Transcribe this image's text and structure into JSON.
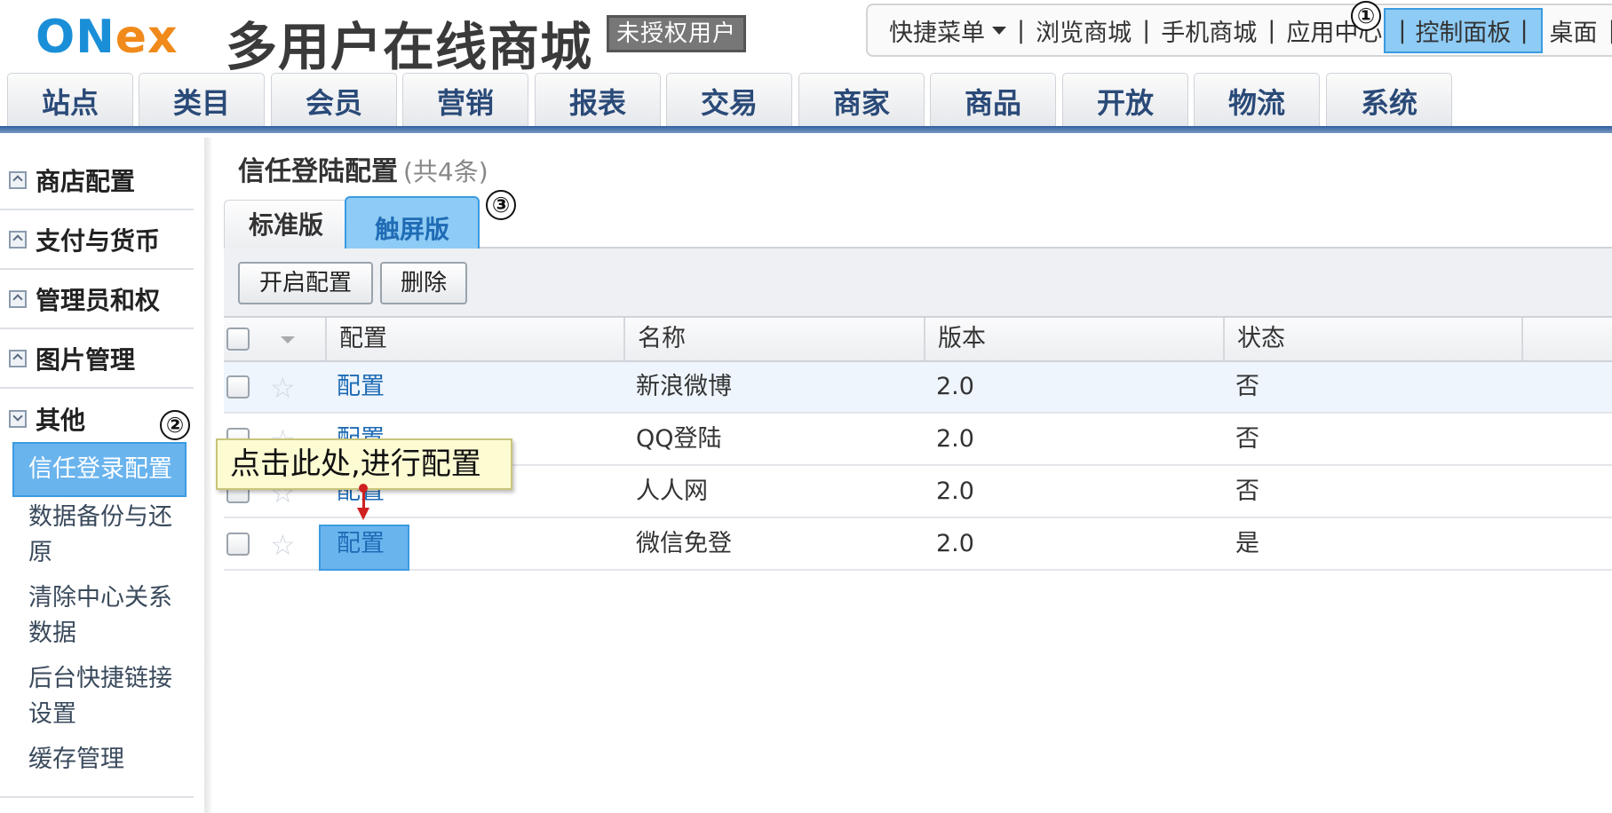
{
  "header": {
    "logo_on": "ON",
    "logo_ex": "ex",
    "site_title": "多用户在线商城",
    "auth_badge": "未授权用户"
  },
  "topmenu": {
    "quick_menu": "快捷菜单",
    "browse_mall": "浏览商城",
    "mobile_mall": "手机商城",
    "app_center": "应用中心",
    "control_panel": "控制面板",
    "desktop": "桌面",
    "separator": "|"
  },
  "nav": {
    "tabs": [
      "站点",
      "类目",
      "会员",
      "营销",
      "报表",
      "交易",
      "商家",
      "商品",
      "开放",
      "物流",
      "系统"
    ]
  },
  "sidebar": {
    "groups": [
      "商店配置",
      "支付与货币",
      "管理员和权",
      "图片管理",
      "其他"
    ],
    "items": [
      "信任登录配置",
      "数据备份与还原",
      "清除中心关系数据",
      "后台快捷链接设置",
      "缓存管理"
    ]
  },
  "markers": [
    "①",
    "②",
    "③"
  ],
  "content": {
    "title": "信任登陆配置",
    "count": "(共4条)",
    "tabs": [
      "标准版",
      "触屏版"
    ],
    "buttons": [
      "开启配置",
      "删除"
    ],
    "columns": [
      "配置",
      "名称",
      "版本",
      "状态"
    ],
    "rows": [
      {
        "action": "配置",
        "name": "新浪微博",
        "version": "2.0",
        "status": "否"
      },
      {
        "action": "配置",
        "name": "QQ登陆",
        "version": "2.0",
        "status": "否"
      },
      {
        "action": "配置",
        "name": "人人网",
        "version": "2.0",
        "status": "否"
      },
      {
        "action": "配置",
        "name": "微信免登",
        "version": "2.0",
        "status": "是"
      }
    ],
    "tooltip": "点击此处,进行配置"
  },
  "colors": {
    "highlight_fill": "#8ecbf5",
    "highlight_border": "#3b9be0",
    "link": "#1f6bb5",
    "nav_text": "#2a4a78",
    "logo_blue": "#1a8fd8",
    "logo_orange": "#f08a1a",
    "tooltip_bg": "#fdfbd2",
    "arrow": "#d02020"
  }
}
